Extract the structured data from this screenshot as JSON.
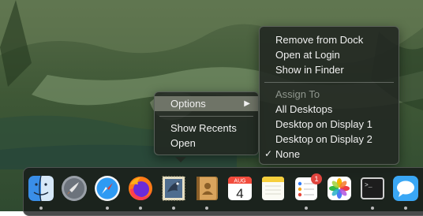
{
  "app_context_menu": {
    "items": [
      {
        "label": "Options",
        "highlighted": true,
        "has_submenu": true
      },
      {
        "label": "Show Recents"
      },
      {
        "label": "Open"
      }
    ],
    "submenu_arrow_icon": "triangle-right-icon"
  },
  "options_submenu": {
    "items": [
      {
        "label": "Remove from Dock"
      },
      {
        "label": "Open at Login"
      },
      {
        "label": "Show in Finder"
      }
    ],
    "assign_heading": "Assign To",
    "assign_options": [
      {
        "label": "All Desktops"
      },
      {
        "label": "Desktop on Display 1"
      },
      {
        "label": "Desktop on Display 2"
      },
      {
        "label": "None",
        "checked": true
      }
    ],
    "check_glyph": "✓"
  },
  "dock": {
    "items": [
      {
        "name": "Finder",
        "icon": "finder-icon",
        "running": true
      },
      {
        "name": "Launchpad",
        "icon": "rocket-icon",
        "running": false
      },
      {
        "name": "Safari",
        "icon": "compass-icon",
        "running": true
      },
      {
        "name": "Firefox",
        "icon": "firefox-icon",
        "running": true
      },
      {
        "name": "Mail",
        "icon": "eagle-stamp-icon",
        "running": true
      },
      {
        "name": "Contacts",
        "icon": "contacts-book-icon",
        "running": true
      },
      {
        "name": "Calendar",
        "icon": "calendar-icon",
        "running": false,
        "month": "AUG",
        "day": "4"
      },
      {
        "name": "Notes",
        "icon": "notes-icon",
        "running": false
      },
      {
        "name": "Reminders",
        "icon": "reminders-icon",
        "running": true,
        "badge": "1"
      },
      {
        "name": "Photos",
        "icon": "photos-flower-icon",
        "running": false
      },
      {
        "name": "Terminal",
        "icon": "terminal-icon",
        "running": true,
        "prompt": ">_"
      },
      {
        "name": "Messages",
        "icon": "speech-bubble-icon",
        "running": true
      }
    ]
  },
  "colors": {
    "menu_bg": "#222822",
    "menu_highlight": "#73786c",
    "badge_red": "#e0443e",
    "wallpaper_green": "#3f5a34"
  }
}
